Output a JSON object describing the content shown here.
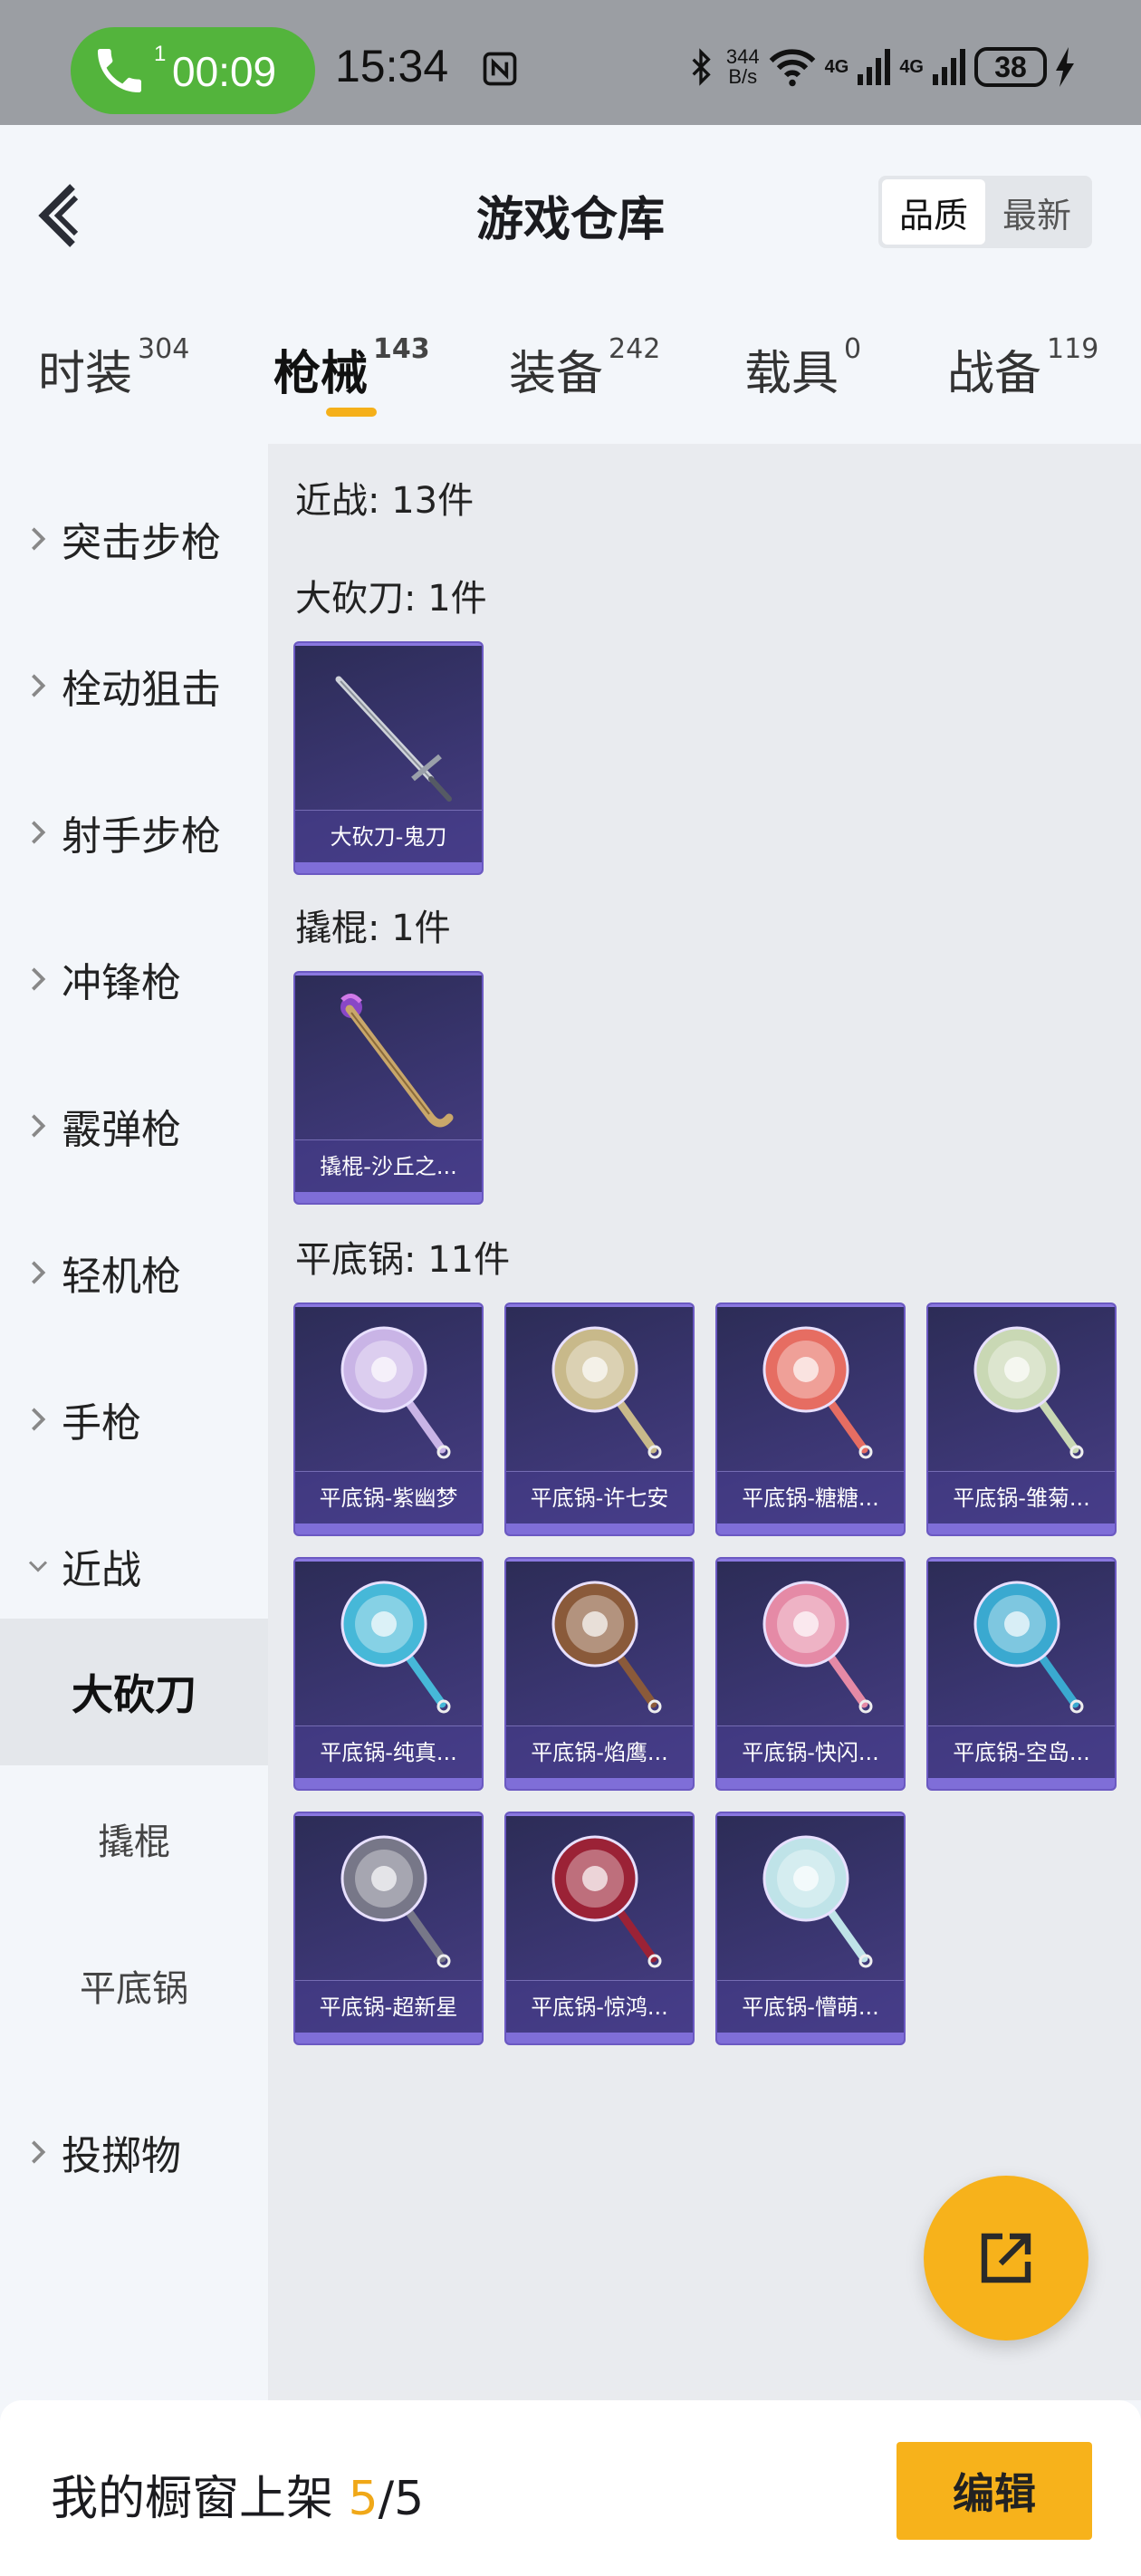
{
  "status_bar": {
    "sim": "1",
    "call_timer": "00:09",
    "time": "15:34",
    "net_speed_value": "344",
    "net_speed_unit": "B/s",
    "signal_1": "4G",
    "signal_2": "4G",
    "battery": "38"
  },
  "header": {
    "title": "游戏仓库",
    "sort_options": [
      "品质",
      "最新"
    ],
    "sort_selected": "品质"
  },
  "tabs": [
    {
      "label": "时装",
      "count": "304"
    },
    {
      "label": "枪械",
      "count": "143"
    },
    {
      "label": "装备",
      "count": "242"
    },
    {
      "label": "载具",
      "count": "0"
    },
    {
      "label": "战备",
      "count": "119"
    }
  ],
  "active_tab": "枪械",
  "sidebar": {
    "categories": [
      "突击步枪",
      "栓动狙击",
      "射手步枪",
      "冲锋枪",
      "霰弹枪",
      "轻机枪",
      "手枪",
      "近战",
      "投掷物"
    ],
    "expanded": "近战",
    "subcategories": [
      "大砍刀",
      "撬棍",
      "平底锅"
    ],
    "selected_sub": "大砍刀"
  },
  "content": {
    "group_title": "近战: 13件",
    "sections": [
      {
        "title": "大砍刀: 1件",
        "items": [
          "大砍刀-鬼刀"
        ]
      },
      {
        "title": "撬棍: 1件",
        "items": [
          "撬棍-沙丘之..."
        ]
      },
      {
        "title": "平底锅: 11件",
        "items": [
          "平底锅-紫幽梦",
          "平底锅-许七安",
          "平底锅-糖糖...",
          "平底锅-雏菊...",
          "平底锅-纯真...",
          "平底锅-焰鹰...",
          "平底锅-快闪...",
          "平底锅-空岛...",
          "平底锅-超新星",
          "平底锅-惊鸿...",
          "平底锅-懵萌..."
        ]
      }
    ]
  },
  "bottom_bar": {
    "label": "我的橱窗上架 ",
    "current": "5",
    "total": "/5",
    "edit_label": "编辑"
  },
  "colors": {
    "accent": "#f7b21b",
    "card_bg": "#3b3672",
    "call_green": "#53b43c"
  },
  "pan_colors": [
    "#c9b4e6",
    "#c8b98a",
    "#e66d62",
    "#c9d8b4",
    "#46b8d8",
    "#8a5a3a",
    "#e58aa6",
    "#3aa9d0",
    "#777788",
    "#9b2236",
    "#bfe3e8"
  ]
}
